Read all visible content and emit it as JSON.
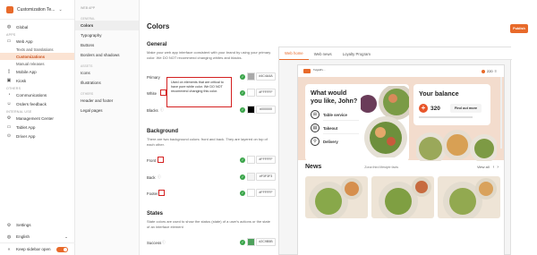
{
  "app": {
    "name": "Customization Te...",
    "brand_color": "#E86A2A"
  },
  "sidebar": {
    "items": [
      {
        "label": "Global",
        "icon": "globe-icon"
      },
      {
        "section": "APPS"
      },
      {
        "label": "Web App",
        "icon": "web-app-icon"
      },
      {
        "sub": "Texts and translations"
      },
      {
        "sub": "Customizations",
        "active": true
      },
      {
        "sub": "Manual releases"
      },
      {
        "label": "Mobile App",
        "icon": "mobile-icon"
      },
      {
        "label": "Kiosk",
        "icon": "kiosk-icon"
      },
      {
        "section": "OTHERS"
      },
      {
        "label": "Communications",
        "icon": "chat-icon"
      },
      {
        "label": "Orders feedback",
        "icon": "feedback-icon"
      },
      {
        "section": "INTERNAL USE"
      },
      {
        "label": "Management Center",
        "icon": "management-icon"
      },
      {
        "label": "Tablet App",
        "icon": "tablet-icon"
      },
      {
        "label": "Driver App",
        "icon": "driver-icon"
      }
    ],
    "settings": "Settings",
    "language": "English",
    "keep_open": "Keep sidebar open"
  },
  "subnav": {
    "title": "WEB APP",
    "sections": [
      {
        "heading": "GENERAL",
        "items": [
          "Colors",
          "Typography",
          "Buttons",
          "Borders and shadows"
        ]
      },
      {
        "heading": "ASSETS",
        "items": [
          "Icons",
          "Illustrations"
        ]
      },
      {
        "heading": "OTHERS",
        "items": [
          "Header and footer",
          "Legal pages"
        ]
      }
    ]
  },
  "page": {
    "title": "Colors",
    "publish": "Publish"
  },
  "general": {
    "title": "General",
    "desc": "Make your web app interface consistent with your brand by using your primary color. We DO NOT recommend changing whites and blacks.",
    "rows": [
      {
        "label": "Primary",
        "hex": "#4C4A4A",
        "color": "#A9A9A9"
      },
      {
        "label": "White",
        "hex": "#FFFFFF",
        "color": "#FFFFFF"
      },
      {
        "label": "Blacks",
        "hex": "#000000",
        "color": "#000000"
      }
    ]
  },
  "tooltip": "Used on elements that are critical to have pure white color. We DO NOT recommend changing this color.",
  "background": {
    "title": "Background",
    "desc": "There are two background colors: front and back. They are layered on top of each other.",
    "rows": [
      {
        "label": "Front",
        "hex": "#FFFFFF",
        "color": "#FFFFFF"
      },
      {
        "label": "Back",
        "hex": "#F3F3F3",
        "color": "#F3F3F3"
      },
      {
        "label": "Footer",
        "hex": "#FFFFFF",
        "color": "#FFFFFF"
      }
    ]
  },
  "states": {
    "title": "States",
    "desc": "State colors are used to show the status (state) of a user's actions or the state of an interface element",
    "rows": [
      {
        "label": "Success",
        "hex": "#2C9B5B",
        "color": "#4EA15C"
      }
    ]
  },
  "preview": {
    "tabs": [
      "Web home",
      "Web news",
      "Loyalty Program"
    ],
    "logo_text": "Twigstill's ...",
    "points": "220",
    "hero_title": "What would you like, John?",
    "options": [
      "Table service",
      "Takeout",
      "Delivery"
    ],
    "balance_title": "Your balance",
    "balance_value": "320",
    "find_out": "Find out more",
    "news_title": "News",
    "news_caption": "Zona third lifestyle facts",
    "view_all": "View all"
  }
}
